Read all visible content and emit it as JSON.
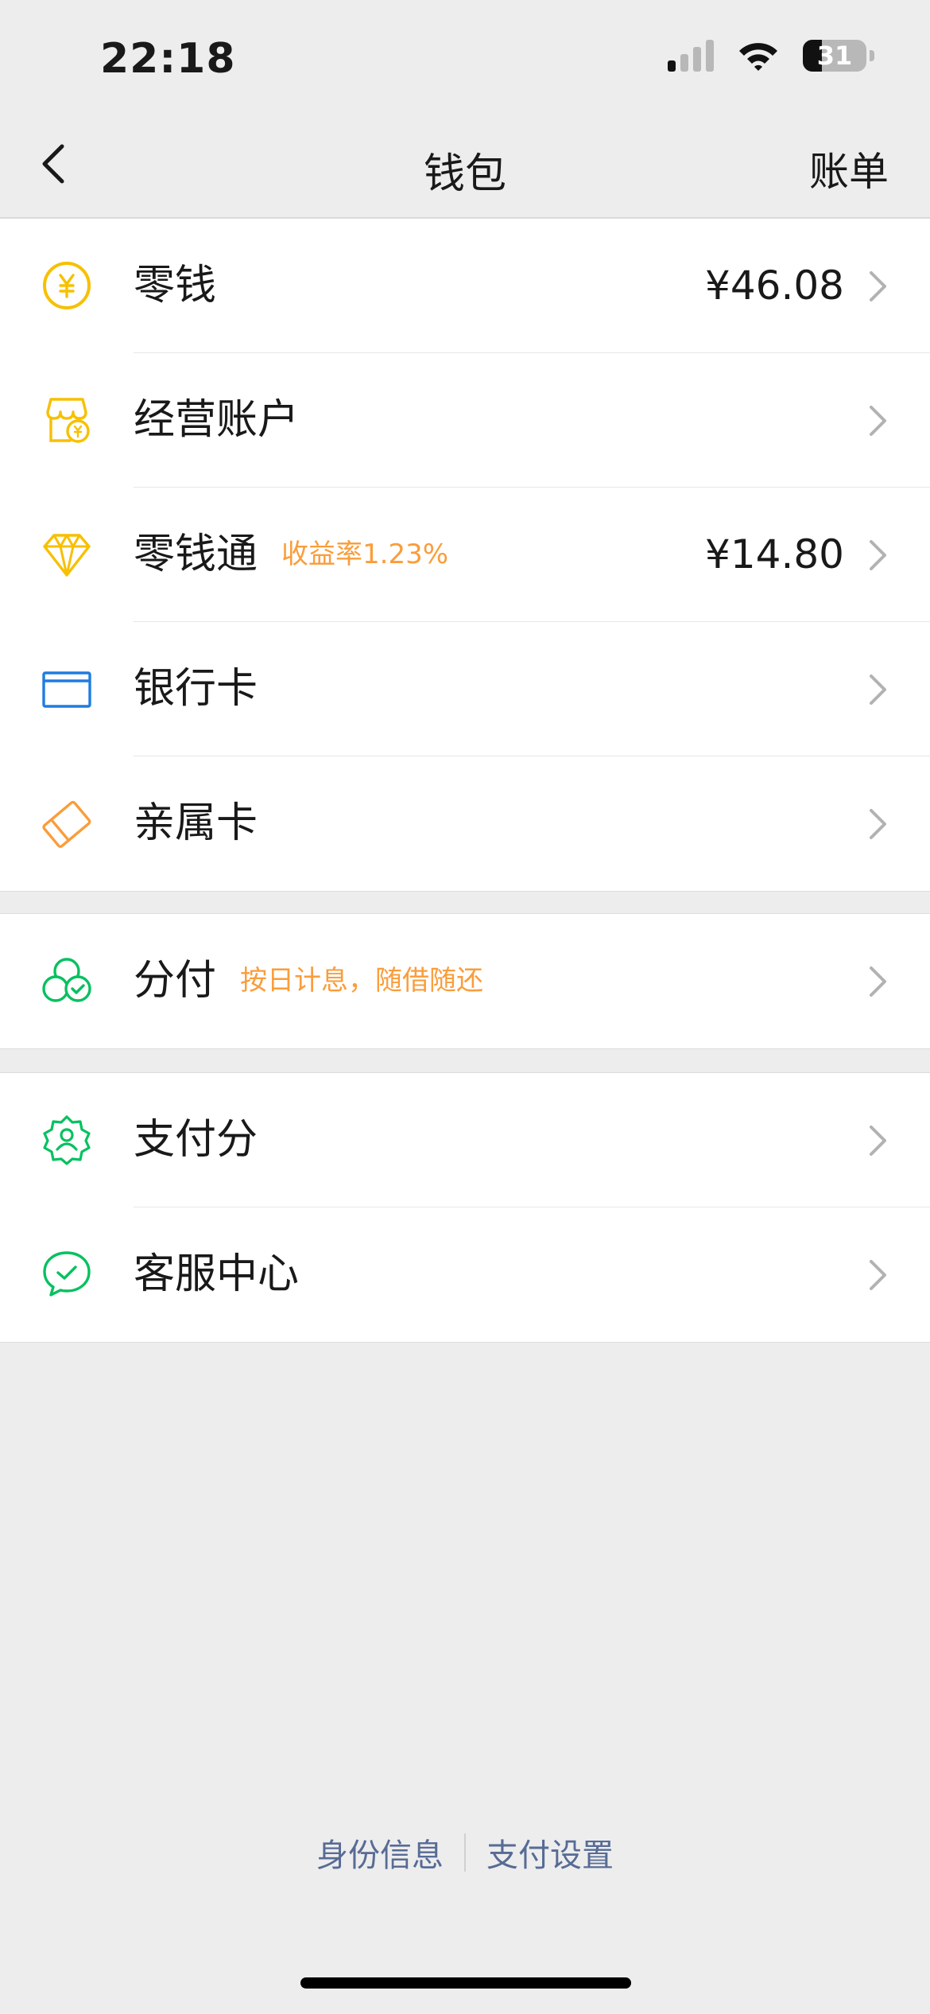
{
  "status_bar": {
    "time": "22:18",
    "battery": "31"
  },
  "nav": {
    "title": "钱包",
    "right_action": "账单"
  },
  "groups": [
    {
      "items": [
        {
          "label": "零钱",
          "value": "¥46.08",
          "icon": "coin-yuan-icon",
          "color": "#f7c000"
        },
        {
          "label": "经营账户",
          "value": "",
          "icon": "storefront-icon",
          "color": "#f7c000"
        },
        {
          "label": "零钱通",
          "tag": "收益率1.23%",
          "value": "¥14.80",
          "icon": "diamond-icon",
          "color": "#f7c000"
        },
        {
          "label": "银行卡",
          "value": "",
          "icon": "bank-card-icon",
          "color": "#1f7ce0"
        },
        {
          "label": "亲属卡",
          "value": "",
          "icon": "family-card-icon",
          "color": "#fa9d3b"
        }
      ]
    },
    {
      "items": [
        {
          "label": "分付",
          "tag": "按日计息，随借随还",
          "value": "",
          "icon": "installment-circles-icon",
          "color": "#07c160"
        }
      ]
    },
    {
      "items": [
        {
          "label": "支付分",
          "value": "",
          "icon": "credit-score-badge-icon",
          "color": "#07c160"
        },
        {
          "label": "客服中心",
          "value": "",
          "icon": "customer-service-chat-icon",
          "color": "#07c160"
        }
      ]
    }
  ],
  "footer": {
    "identity": "身份信息",
    "pay_settings": "支付设置"
  },
  "colors": {
    "accent_orange": "#fa9d3b",
    "link_blue": "#576b95",
    "green": "#07c160",
    "yellow": "#f7c000",
    "blue": "#1f7ce0"
  }
}
